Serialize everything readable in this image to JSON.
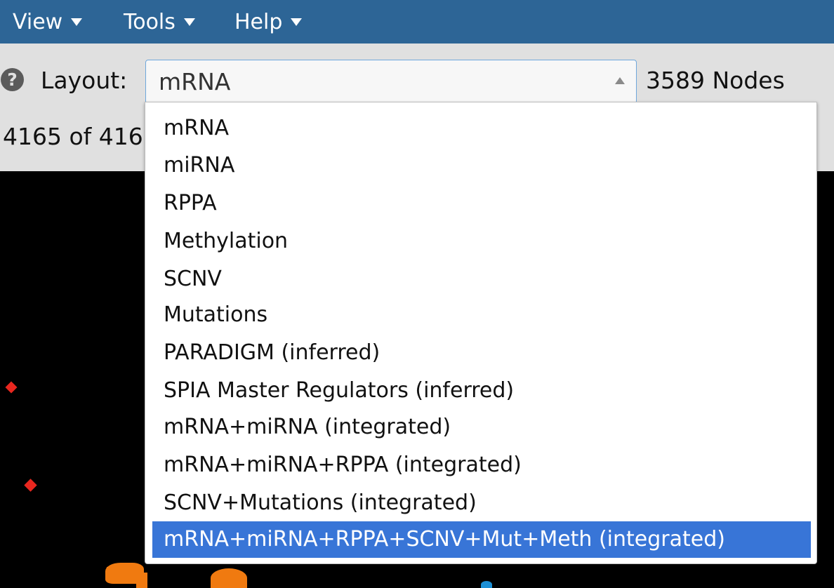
{
  "menubar": {
    "items": [
      {
        "label": "View"
      },
      {
        "label": "Tools"
      },
      {
        "label": "Help"
      }
    ]
  },
  "toolbar": {
    "help_icon": "question-circle-icon",
    "layout_label": "Layout:",
    "layout_select": {
      "value": "mRNA"
    },
    "node_count": "3589 Nodes",
    "filter_count": "4165 of 416"
  },
  "dropdown": {
    "options": [
      {
        "label": "mRNA"
      },
      {
        "label": "miRNA"
      },
      {
        "label": "RPPA"
      },
      {
        "label": "Methylation"
      },
      {
        "label": "SCNV"
      },
      {
        "label": "Mutations"
      },
      {
        "label": "PARADIGM (inferred)"
      },
      {
        "label": "SPIA Master Regulators (inferred)"
      },
      {
        "label": "mRNA+miRNA (integrated)"
      },
      {
        "label": "mRNA+miRNA+RPPA (integrated)"
      },
      {
        "label": "SCNV+Mutations (integrated)"
      },
      {
        "label": "mRNA+miRNA+RPPA+SCNV+Mut+Meth (integrated)"
      }
    ],
    "highlighted": "mRNA+miRNA+RPPA+SCNV+Mut+Meth (integrated)"
  },
  "colors": {
    "menubar_bg": "#2d6596",
    "toolbar_bg": "#e0e0e0",
    "canvas_bg": "#000000",
    "highlight": "#3875d7",
    "node_red": "#e8271f",
    "node_orange": "#f07a10",
    "node_blue": "#1b8fd6"
  }
}
